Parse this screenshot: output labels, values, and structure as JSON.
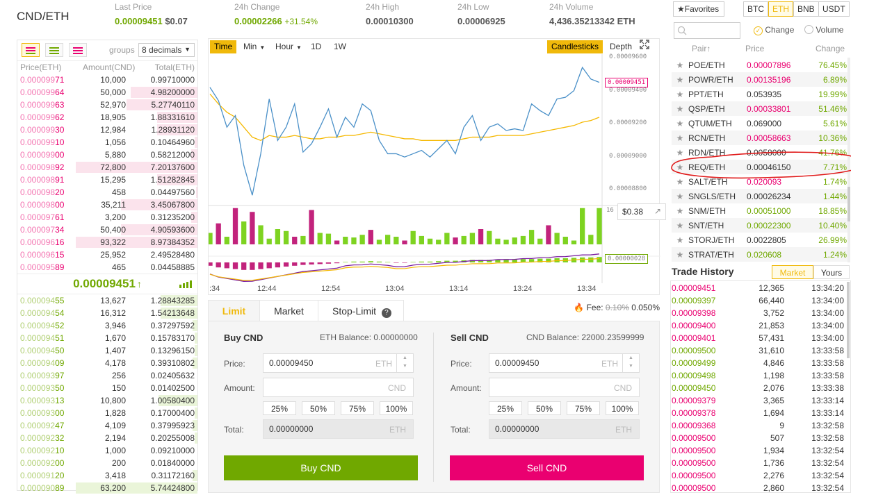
{
  "header": {
    "pair": "CND/ETH",
    "last_price_label": "Last Price",
    "last_price": "0.00009451",
    "last_price_usd": "$0.07",
    "change_label": "24h Change",
    "change": "0.00002266",
    "change_pct": "+31.54%",
    "high_label": "24h High",
    "high": "0.00010300",
    "low_label": "24h Low",
    "low": "0.00006925",
    "volume_label": "24h Volume",
    "volume": "4,436.35213342 ETH"
  },
  "orderbook": {
    "groups_label": "groups",
    "groups_value": "8 decimals",
    "col_price": "Price(ETH)",
    "col_amount": "Amount(CND)",
    "col_total": "Total(ETH)",
    "asks": [
      {
        "p1": "0.000099",
        "p2": "71",
        "a": "10,000",
        "t": "0.99710000",
        "d": 0.0
      },
      {
        "p1": "0.000099",
        "p2": "64",
        "a": "50,000",
        "t": "4.98200000",
        "d": 0.55
      },
      {
        "p1": "0.000099",
        "p2": "63",
        "a": "52,970",
        "t": "5.27740110",
        "d": 0.58
      },
      {
        "p1": "0.000099",
        "p2": "62",
        "a": "18,905",
        "t": "1.88331610",
        "d": 0.33
      },
      {
        "p1": "0.000099",
        "p2": "30",
        "a": "12,984",
        "t": "1.28931120",
        "d": 0.33
      },
      {
        "p1": "0.000099",
        "p2": "10",
        "a": "1,056",
        "t": "0.10464960",
        "d": 0.02
      },
      {
        "p1": "0.000099",
        "p2": "00",
        "a": "5,880",
        "t": "0.58212000",
        "d": 0.05
      },
      {
        "p1": "0.000098",
        "p2": "92",
        "a": "72,800",
        "t": "7.20137600",
        "d": 1.0
      },
      {
        "p1": "0.000098",
        "p2": "91",
        "a": "15,295",
        "t": "1.51282845",
        "d": 0.33
      },
      {
        "p1": "0.000098",
        "p2": "20",
        "a": "458",
        "t": "0.04497560",
        "d": 0.01
      },
      {
        "p1": "0.000098",
        "p2": "00",
        "a": "35,211",
        "t": "3.45067800",
        "d": 0.63
      },
      {
        "p1": "0.000097",
        "p2": "61",
        "a": "3,200",
        "t": "0.31235200",
        "d": 0.05
      },
      {
        "p1": "0.000097",
        "p2": "34",
        "a": "50,400",
        "t": "4.90593600",
        "d": 0.63
      },
      {
        "p1": "0.000096",
        "p2": "16",
        "a": "93,322",
        "t": "8.97384352",
        "d": 1.0
      },
      {
        "p1": "0.000096",
        "p2": "15",
        "a": "25,952",
        "t": "2.49528480",
        "d": 0.0
      },
      {
        "p1": "0.000095",
        "p2": "89",
        "a": "465",
        "t": "0.04458885",
        "d": 0.0
      }
    ],
    "last": "0.00009451",
    "bids": [
      {
        "p1": "0.000094",
        "p2": "55",
        "a": "13,627",
        "t": "1.28843285",
        "d": 0.3
      },
      {
        "p1": "0.000094",
        "p2": "54",
        "a": "16,312",
        "t": "1.54213648",
        "d": 0.3
      },
      {
        "p1": "0.000094",
        "p2": "52",
        "a": "3,946",
        "t": "0.37297592",
        "d": 0.04
      },
      {
        "p1": "0.000094",
        "p2": "51",
        "a": "1,670",
        "t": "0.15783170",
        "d": 0.02
      },
      {
        "p1": "0.000094",
        "p2": "50",
        "a": "1,407",
        "t": "0.13296150",
        "d": 0.02
      },
      {
        "p1": "0.000094",
        "p2": "09",
        "a": "4,178",
        "t": "0.39310802",
        "d": 0.04
      },
      {
        "p1": "0.000093",
        "p2": "97",
        "a": "256",
        "t": "0.02405632",
        "d": 0.0
      },
      {
        "p1": "0.000093",
        "p2": "50",
        "a": "150",
        "t": "0.01402500",
        "d": 0.0
      },
      {
        "p1": "0.000093",
        "p2": "13",
        "a": "10,800",
        "t": "1.00580400",
        "d": 0.32
      },
      {
        "p1": "0.000093",
        "p2": "00",
        "a": "1,828",
        "t": "0.17000400",
        "d": 0.02
      },
      {
        "p1": "0.000092",
        "p2": "47",
        "a": "4,109",
        "t": "0.37995923",
        "d": 0.04
      },
      {
        "p1": "0.000092",
        "p2": "32",
        "a": "2,194",
        "t": "0.20255008",
        "d": 0.02
      },
      {
        "p1": "0.000092",
        "p2": "10",
        "a": "1,000",
        "t": "0.09210000",
        "d": 0.0
      },
      {
        "p1": "0.000092",
        "p2": "00",
        "a": "200",
        "t": "0.01840000",
        "d": 0.0
      },
      {
        "p1": "0.000091",
        "p2": "20",
        "a": "3,418",
        "t": "0.31172160",
        "d": 0.04
      },
      {
        "p1": "0.000090",
        "p2": "89",
        "a": "63,200",
        "t": "5.74424800",
        "d": 1.0
      }
    ]
  },
  "chart": {
    "tabs": [
      "Time",
      "Min",
      "Hour",
      "1D",
      "1W"
    ],
    "candles": "Candlesticks",
    "depth": "Depth",
    "y_labels": [
      "0.00009600",
      "0.00009400",
      "0.00009200",
      "0.00009000",
      "0.00008800"
    ],
    "current": "0.00009451",
    "usd_tip": "$0.38",
    "vol_cut": "16",
    "macd": "0.00000028",
    "x_labels": [
      ":34",
      "12:44",
      "12:54",
      "13:04",
      "13:14",
      "13:24",
      "13:34"
    ],
    "price": [
      9.42e-05,
      9.34e-05,
      9.18e-05,
      9.25e-05,
      8.95e-05,
      8.77e-05,
      9.02e-05,
      9.35e-05,
      9.1e-05,
      9.18e-05,
      9.32e-05,
      9.03e-05,
      9.08e-05,
      9.18e-05,
      9.29e-05,
      9.12e-05,
      9.24e-05,
      9.18e-05,
      9.32e-05,
      9.28e-05,
      9.1e-05,
      9.02e-05,
      9.02e-05,
      9e-05,
      9.02e-05,
      9.04e-05,
      9e-05,
      9.05e-05,
      9.1e-05,
      9.02e-05,
      9.18e-05,
      9.25e-05,
      9.1e-05,
      9.18e-05,
      9.2e-05,
      9.16e-05,
      9.17e-05,
      9.16e-05,
      9.32e-05,
      9.28e-05,
      9.25e-05,
      9.35e-05,
      9.36e-05,
      9.4e-05,
      9.54e-05,
      9.47e-05,
      9.45e-05
    ],
    "ma": [
      9.38e-05,
      9.32e-05,
      9.27e-05,
      9.24e-05,
      9.18e-05,
      9.12e-05,
      9.1e-05,
      9.13e-05,
      9.12e-05,
      9.12e-05,
      9.13e-05,
      9.12e-05,
      9.11e-05,
      9.11e-05,
      9.12e-05,
      9.12e-05,
      9.13e-05,
      9.13e-05,
      9.14e-05,
      9.15e-05,
      9.14e-05,
      9.13e-05,
      9.12e-05,
      9.11e-05,
      9.11e-05,
      9.1e-05,
      9.1e-05,
      9.1e-05,
      9.1e-05,
      9.1e-05,
      9.11e-05,
      9.12e-05,
      9.12e-05,
      9.12e-05,
      9.13e-05,
      9.13e-05,
      9.13e-05,
      9.13e-05,
      9.14e-05,
      9.15e-05,
      9.16e-05,
      9.17e-05,
      9.18e-05,
      9.19e-05,
      9.21e-05,
      9.22e-05,
      9.24e-05
    ],
    "volume": [
      {
        "v": 0.3,
        "up": 1
      },
      {
        "v": 0.55,
        "up": 0
      },
      {
        "v": 0.2,
        "up": 1
      },
      {
        "v": 0.95,
        "up": 0
      },
      {
        "v": 0.6,
        "up": 1
      },
      {
        "v": 0.85,
        "up": 0
      },
      {
        "v": 0.5,
        "up": 1
      },
      {
        "v": 0.15,
        "up": 1
      },
      {
        "v": 0.4,
        "up": 1
      },
      {
        "v": 0.35,
        "up": 1
      },
      {
        "v": 0.2,
        "up": 0
      },
      {
        "v": 0.22,
        "up": 1
      },
      {
        "v": 0.9,
        "up": 0
      },
      {
        "v": 0.3,
        "up": 1
      },
      {
        "v": 0.28,
        "up": 1
      },
      {
        "v": 0.1,
        "up": 0
      },
      {
        "v": 0.2,
        "up": 1
      },
      {
        "v": 0.18,
        "up": 1
      },
      {
        "v": 0.25,
        "up": 1
      },
      {
        "v": 0.38,
        "up": 0
      },
      {
        "v": 0.12,
        "up": 1
      },
      {
        "v": 0.25,
        "up": 1
      },
      {
        "v": 0.2,
        "up": 1
      },
      {
        "v": 0.1,
        "up": 0
      },
      {
        "v": 0.35,
        "up": 1
      },
      {
        "v": 0.22,
        "up": 1
      },
      {
        "v": 0.15,
        "up": 1
      },
      {
        "v": 0.12,
        "up": 1
      },
      {
        "v": 0.3,
        "up": 1
      },
      {
        "v": 0.18,
        "up": 0
      },
      {
        "v": 0.22,
        "up": 1
      },
      {
        "v": 0.3,
        "up": 1
      },
      {
        "v": 0.4,
        "up": 0
      },
      {
        "v": 0.35,
        "up": 1
      },
      {
        "v": 0.15,
        "up": 1
      },
      {
        "v": 0.12,
        "up": 1
      },
      {
        "v": 0.18,
        "up": 1
      },
      {
        "v": 0.22,
        "up": 1
      },
      {
        "v": 0.38,
        "up": 1
      },
      {
        "v": 0.15,
        "up": 1
      },
      {
        "v": 0.5,
        "up": 0
      },
      {
        "v": 0.3,
        "up": 1
      },
      {
        "v": 0.2,
        "up": 1
      },
      {
        "v": 0.1,
        "up": 1
      },
      {
        "v": 0.95,
        "up": 1
      },
      {
        "v": 0.25,
        "up": 1
      },
      {
        "v": 0.95,
        "up": 1
      }
    ],
    "macd_hist": [
      -0.4,
      -0.6,
      -0.7,
      -0.8,
      -0.9,
      -0.9,
      -0.8,
      -0.7,
      -0.6,
      -0.5,
      -0.4,
      -0.3,
      -0.25,
      -0.2,
      -0.15,
      -0.1,
      0.05,
      0.1,
      0.1,
      0.15,
      0.1,
      0.05,
      -0.05,
      -0.05,
      0.05,
      0.1,
      0.1,
      0.15,
      0.2,
      0.2,
      0.25,
      0.3,
      0.3,
      0.3,
      0.35,
      0.35,
      0.35,
      0.4,
      0.4,
      0.45,
      0.45,
      0.5,
      0.5,
      0.55,
      0.6,
      0.6,
      0.65
    ]
  },
  "form": {
    "tab_limit": "Limit",
    "tab_market": "Market",
    "tab_stop": "Stop-Limit",
    "fee_label": "Fee:",
    "fee_old": "0.10%",
    "fee_new": "0.050%",
    "buy_title": "Buy CND",
    "buy_balance": "ETH Balance: 0.00000000",
    "sell_title": "Sell CND",
    "sell_balance": "CND Balance: 22000.23599999",
    "price_label": "Price:",
    "amount_label": "Amount:",
    "total_label": "Total:",
    "price_value": "0.00009450",
    "unit_eth": "ETH",
    "unit_cnd": "CND",
    "total_value": "0.00000000",
    "pcts": [
      "25%",
      "50%",
      "75%",
      "100%"
    ],
    "buy_btn": "Buy CND",
    "sell_btn": "Sell CND"
  },
  "markets": {
    "favorites": "Favorites",
    "tabs": [
      "BTC",
      "ETH",
      "BNB",
      "USDT"
    ],
    "active_tab": "ETH",
    "radio_change": "Change",
    "radio_volume": "Volume",
    "col_pair": "Pair",
    "col_price": "Price",
    "col_change": "Change",
    "rows": [
      {
        "pair": "POE/ETH",
        "price": "0.00007896",
        "change": "76.45%",
        "c": "red"
      },
      {
        "pair": "POWR/ETH",
        "price": "0.00135196",
        "change": "6.89%",
        "c": "red"
      },
      {
        "pair": "PPT/ETH",
        "price": "0.053935",
        "change": "19.99%",
        "c": "gray"
      },
      {
        "pair": "QSP/ETH",
        "price": "0.00033801",
        "change": "51.46%",
        "c": "red"
      },
      {
        "pair": "QTUM/ETH",
        "price": "0.069000",
        "change": "5.61%",
        "c": "gray"
      },
      {
        "pair": "RCN/ETH",
        "price": "0.00058663",
        "change": "10.36%",
        "c": "red"
      },
      {
        "pair": "RDN/ETH",
        "price": "0.0058000",
        "change": "41.76%",
        "c": "gray"
      },
      {
        "pair": "REQ/ETH",
        "price": "0.00046150",
        "change": "7.71%",
        "c": "gray"
      },
      {
        "pair": "SALT/ETH",
        "price": "0.020093",
        "change": "1.74%",
        "c": "red"
      },
      {
        "pair": "SNGLS/ETH",
        "price": "0.00026234",
        "change": "1.44%",
        "c": "gray"
      },
      {
        "pair": "SNM/ETH",
        "price": "0.00051000",
        "change": "18.85%",
        "c": "green"
      },
      {
        "pair": "SNT/ETH",
        "price": "0.00022300",
        "change": "10.40%",
        "c": "green"
      },
      {
        "pair": "STORJ/ETH",
        "price": "0.0022805",
        "change": "26.99%",
        "c": "gray"
      },
      {
        "pair": "STRAT/ETH",
        "price": "0.020608",
        "change": "1.24%",
        "c": "green"
      }
    ]
  },
  "history": {
    "title": "Trade History",
    "tab_market": "Market",
    "tab_yours": "Yours",
    "rows": [
      {
        "p": "0.00009451",
        "a": "12,365",
        "t": "13:34:20",
        "c": "red"
      },
      {
        "p": "0.00009397",
        "a": "66,440",
        "t": "13:34:00",
        "c": "green"
      },
      {
        "p": "0.00009398",
        "a": "3,752",
        "t": "13:34:00",
        "c": "red"
      },
      {
        "p": "0.00009400",
        "a": "21,853",
        "t": "13:34:00",
        "c": "red"
      },
      {
        "p": "0.00009401",
        "a": "57,431",
        "t": "13:34:00",
        "c": "red"
      },
      {
        "p": "0.00009500",
        "a": "31,610",
        "t": "13:33:58",
        "c": "green"
      },
      {
        "p": "0.00009499",
        "a": "4,846",
        "t": "13:33:58",
        "c": "green"
      },
      {
        "p": "0.00009498",
        "a": "1,198",
        "t": "13:33:58",
        "c": "green"
      },
      {
        "p": "0.00009450",
        "a": "2,076",
        "t": "13:33:38",
        "c": "green"
      },
      {
        "p": "0.00009379",
        "a": "3,365",
        "t": "13:33:14",
        "c": "red"
      },
      {
        "p": "0.00009378",
        "a": "1,694",
        "t": "13:33:14",
        "c": "red"
      },
      {
        "p": "0.00009368",
        "a": "9",
        "t": "13:32:58",
        "c": "red"
      },
      {
        "p": "0.00009500",
        "a": "507",
        "t": "13:32:58",
        "c": "red"
      },
      {
        "p": "0.00009500",
        "a": "1,934",
        "t": "13:32:54",
        "c": "red"
      },
      {
        "p": "0.00009500",
        "a": "1,736",
        "t": "13:32:54",
        "c": "red"
      },
      {
        "p": "0.00009500",
        "a": "2,276",
        "t": "13:32:54",
        "c": "red"
      },
      {
        "p": "0.00009500",
        "a": "2,860",
        "t": "13:32:54",
        "c": "red"
      }
    ]
  }
}
